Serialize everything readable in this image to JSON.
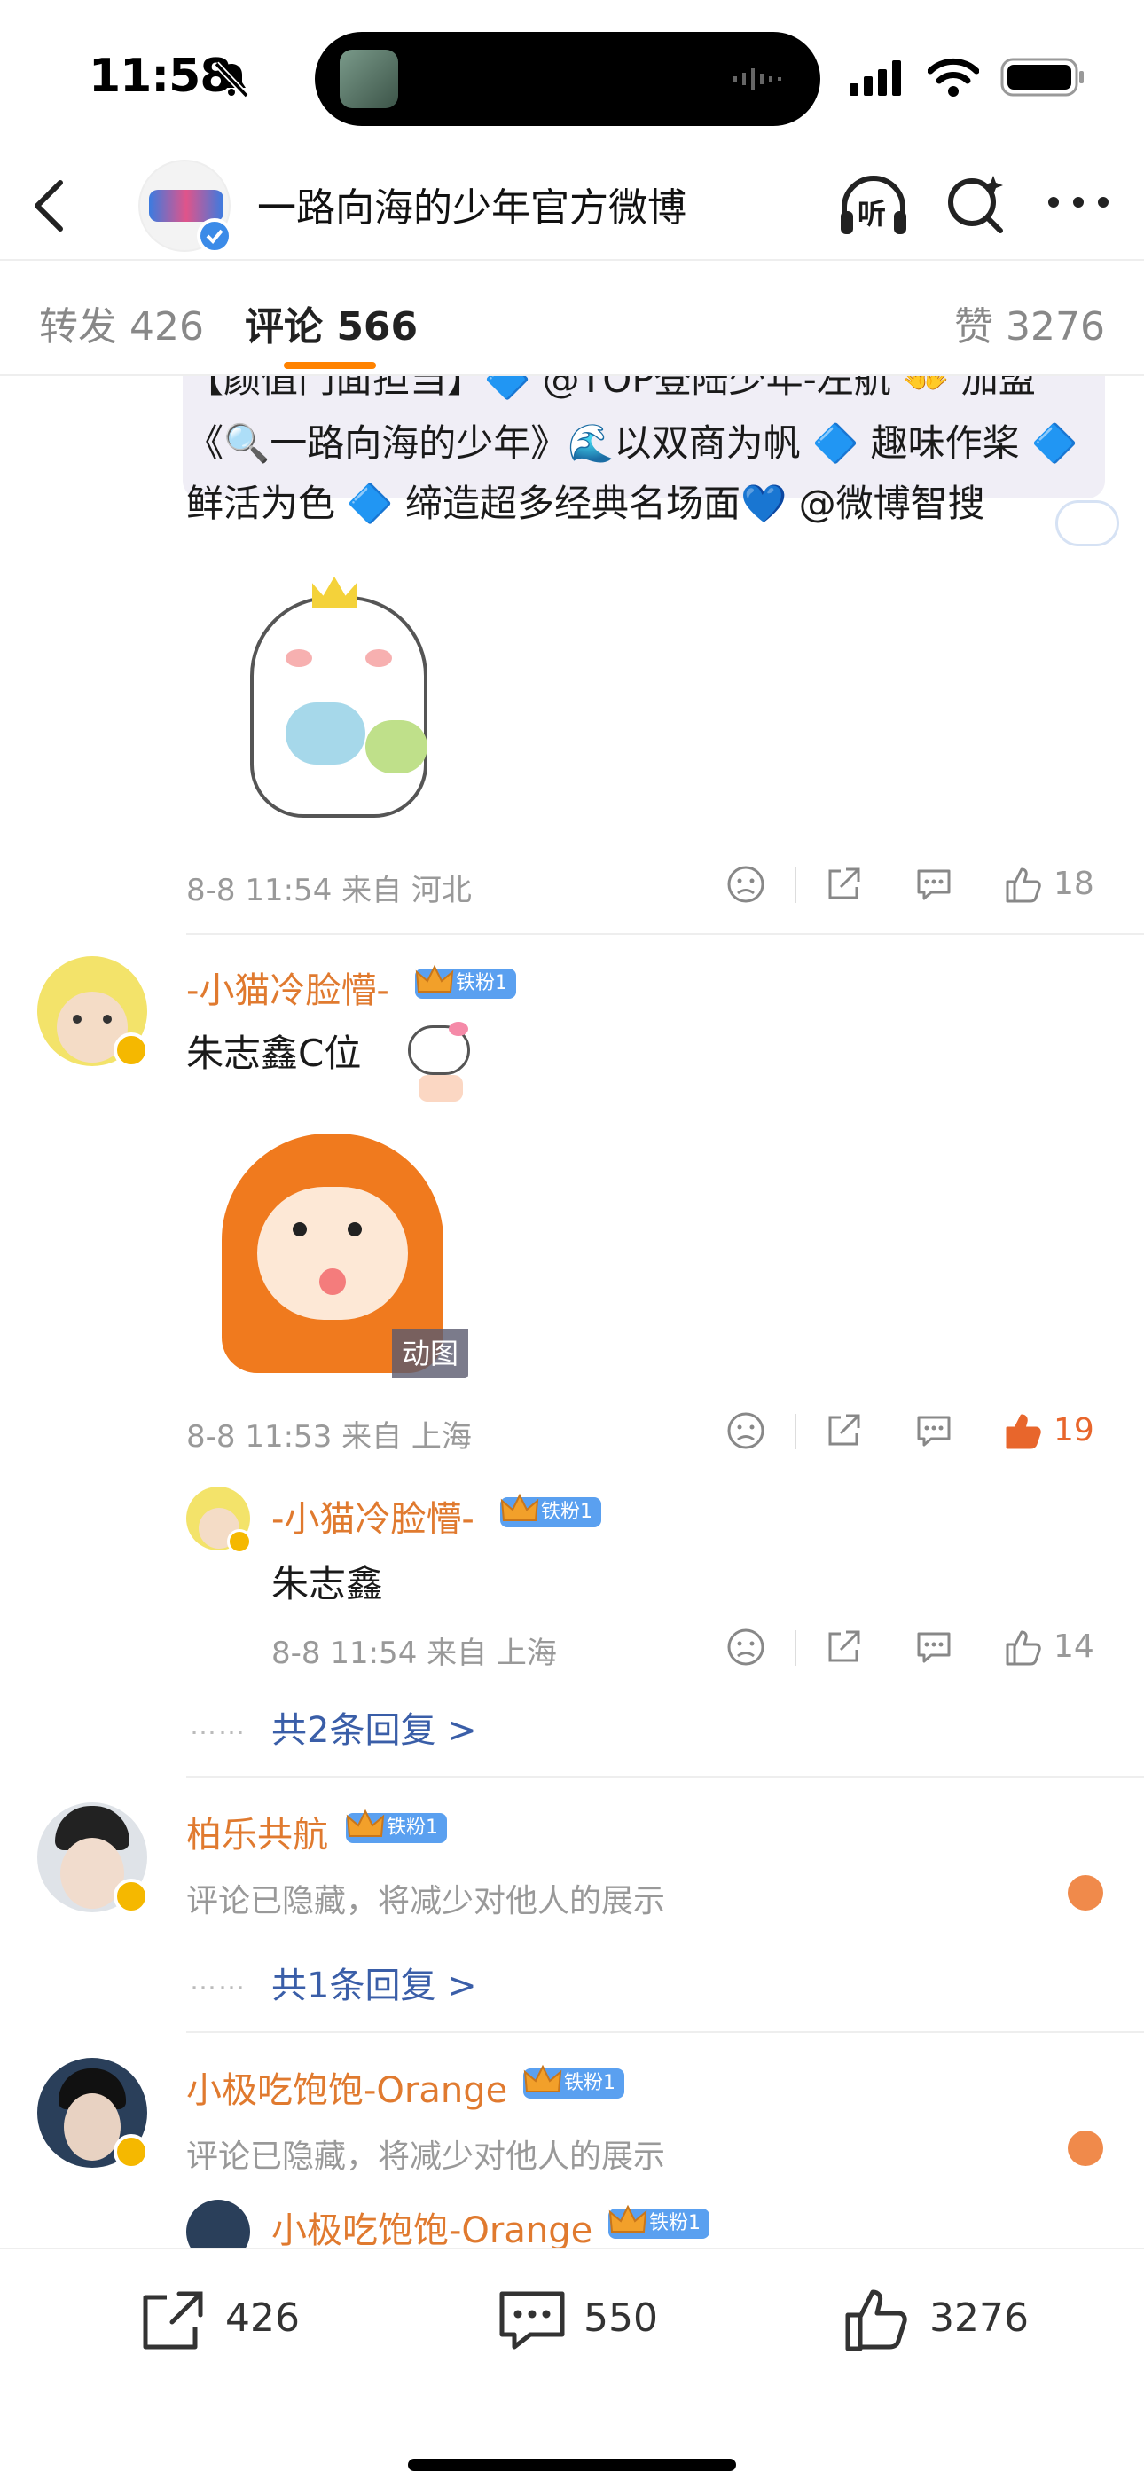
{
  "status_bar": {
    "time": "11:58"
  },
  "header": {
    "title": "一路向海的少年官方微博",
    "listen_label": "听"
  },
  "tabs": [
    {
      "label": "转发 426"
    },
    {
      "label": "评论 566"
    },
    {
      "label": "赞 3276"
    }
  ],
  "post": {
    "line1": "【颜值门面担当】🔷 @TOP登陆少年-左航 👐 加盟",
    "line2": "《🔍一路向海的少年》🌊以双商为帆 🔷 趣味作桨 🔷",
    "line3": "鲜活为色 🔷 缔造超多经典名场面💙 @微博智搜",
    "meta": "8-8 11:54 来自 河北",
    "likes": "18"
  },
  "comments": [
    {
      "username": "-小猫冷脸懵-",
      "badge": "铁粉1",
      "text": "朱志鑫C位",
      "gif_label": "动图",
      "meta": "8-8 11:53 来自 上海",
      "likes": "19",
      "reply": {
        "username": "-小猫冷脸懵-",
        "badge": "铁粉1",
        "text": "朱志鑫",
        "meta": "8-8 11:54 来自 上海",
        "likes": "14"
      },
      "more_replies": "共2条回复 >"
    },
    {
      "username": "柏乐共航",
      "badge": "铁粉1",
      "text": "评论已隐藏，将减少对他人的展示",
      "more_replies": "共1条回复 >"
    },
    {
      "username": "小极吃饱饱-Orange",
      "badge": "铁粉1",
      "text": "评论已隐藏，将减少对他人的展示",
      "reply": {
        "username": "小极吃饱饱-Orange",
        "badge": "铁粉1"
      }
    }
  ],
  "dots": "……",
  "bottom_bar": {
    "repost_count": "426",
    "comment_count": "550",
    "like_count": "3276"
  },
  "colors": {
    "accent": "#ff8200",
    "username": "#e07a2f",
    "link": "#3a5ea8",
    "liked": "#e8662c"
  }
}
